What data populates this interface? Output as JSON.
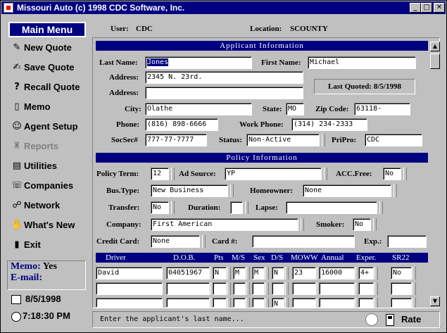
{
  "window": {
    "title": "Missouri Auto  (c) 1998 CDC Software, Inc."
  },
  "sidebar": {
    "title": "Main Menu",
    "items": [
      {
        "label": "New Quote",
        "icon": "new-quote-icon",
        "glyph": "✎",
        "enabled": true
      },
      {
        "label": "Save Quote",
        "icon": "save-quote-icon",
        "glyph": "✍",
        "enabled": true
      },
      {
        "label": "Recall Quote",
        "icon": "recall-quote-icon",
        "glyph": "?",
        "enabled": true
      },
      {
        "label": "Memo",
        "icon": "memo-icon",
        "glyph": "▯",
        "enabled": true
      },
      {
        "label": "Agent Setup",
        "icon": "agent-setup-icon",
        "glyph": "☺",
        "enabled": true
      },
      {
        "label": "Reports",
        "icon": "reports-icon",
        "glyph": "♜",
        "enabled": false
      },
      {
        "label": "Utilities",
        "icon": "utilities-icon",
        "glyph": "▤",
        "enabled": true
      },
      {
        "label": "Companies",
        "icon": "companies-icon",
        "glyph": "☏",
        "enabled": true
      },
      {
        "label": "Network",
        "icon": "network-icon",
        "glyph": "☍",
        "enabled": true
      },
      {
        "label": "What's New",
        "icon": "whats-new-icon",
        "glyph": "✋",
        "enabled": true
      },
      {
        "label": "Exit",
        "icon": "exit-icon",
        "glyph": "▮",
        "enabled": true
      }
    ],
    "memo_label": "Memo:",
    "memo_value": "Yes",
    "email_label": "E-mail:",
    "date": "8/5/1998",
    "time": "7:18:30 PM"
  },
  "header": {
    "user_label": "User:",
    "user": "CDC",
    "location_label": "Location:",
    "location": "SCOUNTY"
  },
  "applicant": {
    "section_title": "Applicant Information",
    "last_name_label": "Last Name:",
    "last_name": "Jones",
    "first_name_label": "First Name:",
    "first_name": "Michael",
    "address_label": "Address:",
    "address1": "2345 N. 23rd.",
    "address2_label": "Address:",
    "address2": "",
    "last_quoted": "Last Quoted: 8/5/1998",
    "city_label": "City:",
    "city": "Olathe",
    "state_label": "State:",
    "state": "MO",
    "zip_label": "Zip Code:",
    "zip": "63118-",
    "phone_label": "Phone:",
    "phone": "(816) 898-6666",
    "work_phone_label": "Work Phone:",
    "work_phone": "(314) 234-2333",
    "socsec_label": "SocSec#",
    "socsec": "777-77-7777",
    "status_label": "Status:",
    "status": "Non-Active",
    "pripro_label": "PriPro:",
    "pripro": "CDC"
  },
  "policy": {
    "section_title": "Policy Information",
    "term_label": "Policy Term:",
    "term": "12",
    "ad_source_label": "Ad Source:",
    "ad_source": "YP",
    "acc_free_label": "ACC.Free:",
    "acc_free": "No",
    "bus_type_label": "Bus.Type:",
    "bus_type": "New Business",
    "homeowner_label": "Homeowner:",
    "homeowner": "None",
    "transfer_label": "Transfer:",
    "transfer": "No",
    "duration_label": "Duration:",
    "duration": "",
    "lapse_label": "Lapse:",
    "lapse": "",
    "company_label": "Company:",
    "company": "First American",
    "smoker_label": "Smoker:",
    "smoker": "No",
    "credit_card_label": "Credit Card:",
    "credit_card": "None",
    "card_num_label": "Card #:",
    "card_num": "",
    "exp_label": "Exp.:",
    "exp": ""
  },
  "drivers": {
    "headers": [
      "Driver",
      "D.O.B.",
      "Pts",
      "M/S",
      "Sex",
      "D/S",
      "MOWW",
      "Annual",
      "Exper.",
      "SR22"
    ],
    "rows": [
      [
        "David",
        "04051967",
        "N",
        "M",
        "M",
        "N",
        "23",
        "16000",
        "4+",
        "No"
      ],
      [
        "",
        "",
        "",
        "",
        "",
        "",
        "",
        "",
        "",
        ""
      ],
      [
        "",
        "",
        "",
        "",
        "",
        "N",
        "",
        "",
        "",
        ""
      ]
    ]
  },
  "status_bar": {
    "message": "Enter the applicant's last name...",
    "rate_label": "Rate"
  }
}
